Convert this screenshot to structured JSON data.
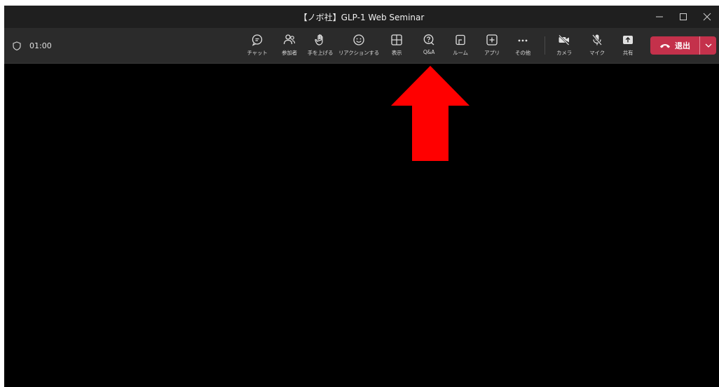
{
  "window": {
    "title": "【ノボ社】GLP-1 Web Seminar"
  },
  "meeting": {
    "elapsed_time": "01:00"
  },
  "toolbar": {
    "items": [
      {
        "id": "chat",
        "label": "チャット",
        "icon": "chat-icon"
      },
      {
        "id": "participants",
        "label": "参加者",
        "icon": "people-icon"
      },
      {
        "id": "raise-hand",
        "label": "手を上げる",
        "icon": "hand-icon"
      },
      {
        "id": "reactions",
        "label": "リアクションする",
        "icon": "smiley-icon"
      },
      {
        "id": "view",
        "label": "表示",
        "icon": "grid-icon"
      },
      {
        "id": "qa",
        "label": "Q&A",
        "icon": "question-bubble-icon"
      },
      {
        "id": "rooms",
        "label": "ルーム",
        "icon": "rooms-icon"
      },
      {
        "id": "apps",
        "label": "アプリ",
        "icon": "add-app-icon"
      },
      {
        "id": "more",
        "label": "その他",
        "icon": "ellipsis-icon"
      },
      {
        "id": "camera",
        "label": "カメラ",
        "icon": "camera-off-icon"
      },
      {
        "id": "mic",
        "label": "マイク",
        "icon": "mic-off-icon"
      },
      {
        "id": "share",
        "label": "共有",
        "icon": "share-icon"
      }
    ],
    "leave_label": "退出"
  },
  "colors": {
    "leave_button": "#c4314b",
    "annotation_arrow": "#ff0000",
    "toolbar_bg": "#2b2b2b",
    "stage_bg": "#000000"
  }
}
